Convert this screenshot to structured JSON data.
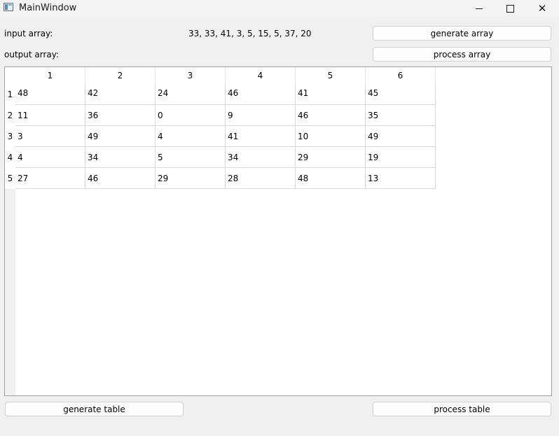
{
  "window": {
    "title": "MainWindow"
  },
  "controls": {
    "input_label": "input array:",
    "input_value": "33, 33, 41, 3, 5, 15, 5, 37, 20",
    "output_label": "output array:",
    "generate_array_label": "generate array",
    "process_array_label": "process array",
    "generate_table_label": "generate table",
    "process_table_label": "process table"
  },
  "table": {
    "columns": [
      "1",
      "2",
      "3",
      "4",
      "5",
      "6"
    ],
    "row_headers": [
      "1",
      "2",
      "3",
      "4",
      "5"
    ],
    "rows": [
      [
        "48",
        "42",
        "24",
        "46",
        "41",
        "45"
      ],
      [
        "11",
        "36",
        "0",
        "9",
        "46",
        "35"
      ],
      [
        "3",
        "49",
        "4",
        "41",
        "10",
        "49"
      ],
      [
        "4",
        "34",
        "5",
        "34",
        "29",
        "19"
      ],
      [
        "27",
        "46",
        "29",
        "28",
        "48",
        "13"
      ]
    ]
  }
}
